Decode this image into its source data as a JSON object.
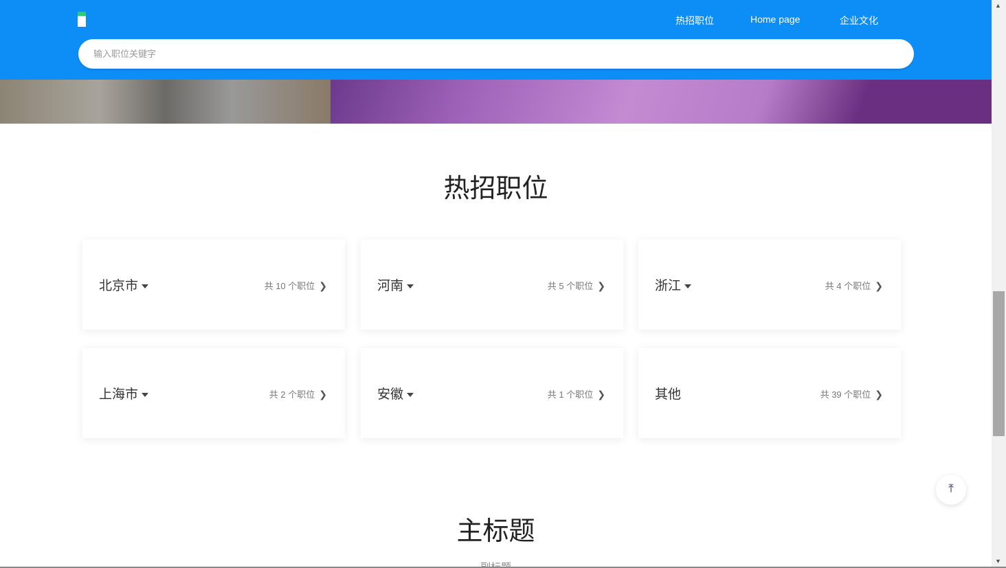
{
  "header": {
    "nav": [
      "热招职位",
      "Home page",
      "企业文化"
    ],
    "search_placeholder": "输入职位关键字"
  },
  "hot": {
    "title": "热招职位",
    "cards": [
      {
        "city": "北京市",
        "count": "共 10 个职位",
        "dropdown": true
      },
      {
        "city": "河南",
        "count": "共 5 个职位",
        "dropdown": true
      },
      {
        "city": "浙江",
        "count": "共 4 个职位",
        "dropdown": true
      },
      {
        "city": "上海市",
        "count": "共 2 个职位",
        "dropdown": true
      },
      {
        "city": "安徽",
        "count": "共 1 个职位",
        "dropdown": true
      },
      {
        "city": "其他",
        "count": "共 39 个职位",
        "dropdown": false
      }
    ]
  },
  "section2": {
    "title": "主标题",
    "subtitle": "副标题"
  },
  "icons": {
    "back_to_top": "arrow-up-to-line-icon"
  }
}
